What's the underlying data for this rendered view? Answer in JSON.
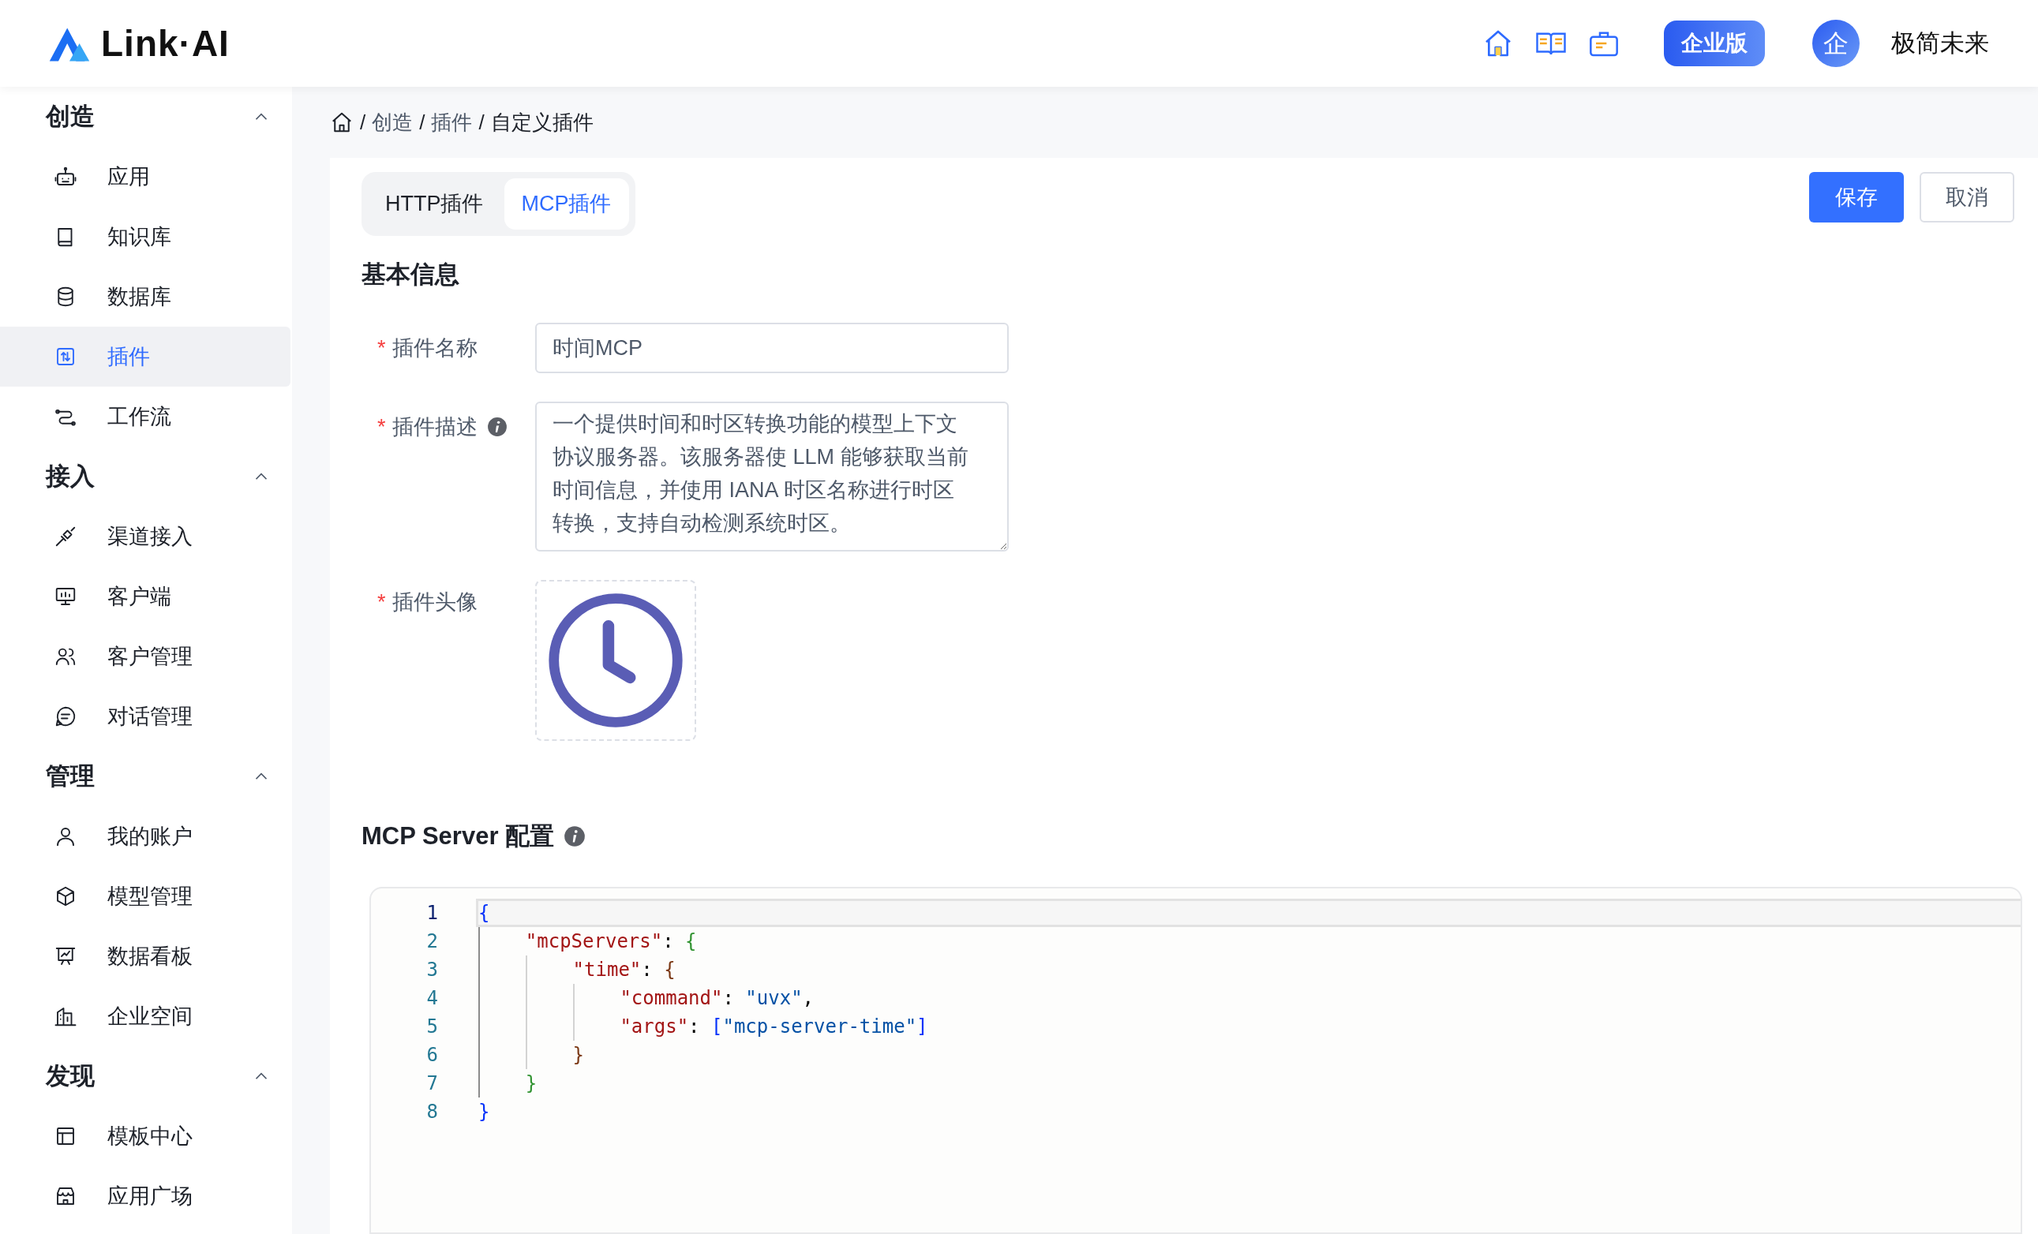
{
  "header": {
    "logo_text": "Link·AI",
    "enterprise_button": "企业版",
    "avatar_text": "企",
    "user_name": "极简未来"
  },
  "sidebar": {
    "groups": [
      {
        "title": "创造",
        "expanded": true,
        "items": [
          {
            "label": "应用",
            "selected": false
          },
          {
            "label": "知识库",
            "selected": false
          },
          {
            "label": "数据库",
            "selected": false
          },
          {
            "label": "插件",
            "selected": true
          },
          {
            "label": "工作流",
            "selected": false
          }
        ]
      },
      {
        "title": "接入",
        "expanded": true,
        "items": [
          {
            "label": "渠道接入",
            "selected": false
          },
          {
            "label": "客户端",
            "selected": false
          },
          {
            "label": "客户管理",
            "selected": false
          },
          {
            "label": "对话管理",
            "selected": false
          }
        ]
      },
      {
        "title": "管理",
        "expanded": true,
        "items": [
          {
            "label": "我的账户",
            "selected": false
          },
          {
            "label": "模型管理",
            "selected": false
          },
          {
            "label": "数据看板",
            "selected": false
          },
          {
            "label": "企业空间",
            "selected": false
          }
        ]
      },
      {
        "title": "发现",
        "expanded": true,
        "items": [
          {
            "label": "模板中心",
            "selected": false
          },
          {
            "label": "应用广场",
            "selected": false
          }
        ]
      }
    ]
  },
  "breadcrumb": [
    {
      "separator": "/",
      "label": "创造",
      "current": false
    },
    {
      "separator": "/",
      "label": "插件",
      "current": false
    },
    {
      "separator": "/",
      "label": "自定义插件",
      "current": true
    }
  ],
  "tabs": [
    {
      "label": "HTTP插件",
      "selected": false
    },
    {
      "label": "MCP插件",
      "selected": true
    }
  ],
  "actions": {
    "save": "保存",
    "cancel": "取消"
  },
  "basic_info": {
    "title": "基本信息",
    "fields": [
      {
        "kind": "text",
        "required_mark": "*",
        "label": "插件名称",
        "value": "时间MCP"
      },
      {
        "kind": "textarea",
        "required_mark": "*",
        "label": "插件描述",
        "info": true,
        "value": "一个提供时间和时区转换功能的模型上下文协议服务器。该服务器使 LLM 能够获取当前时间信息，并使用 IANA 时区名称进行时区转换，支持自动检测系统时区。"
      },
      {
        "kind": "avatar",
        "required_mark": "*",
        "label": "插件头像"
      }
    ]
  },
  "mcp_config": {
    "title": "MCP Server 配置",
    "info": true,
    "lines": [
      {
        "number": "1",
        "current": true,
        "tokens": [
          {
            "kind": "brace0",
            "text": "{"
          }
        ]
      },
      {
        "number": "2",
        "current": false,
        "tokens": [
          {
            "kind": "key",
            "text": "    \"mcpServers\""
          },
          {
            "kind": "punct",
            "text": ": "
          },
          {
            "kind": "brace1",
            "text": "{"
          }
        ]
      },
      {
        "number": "3",
        "current": false,
        "tokens": [
          {
            "kind": "key",
            "text": "        \"time\""
          },
          {
            "kind": "punct",
            "text": ": "
          },
          {
            "kind": "brace2",
            "text": "{"
          }
        ]
      },
      {
        "number": "4",
        "current": false,
        "tokens": [
          {
            "kind": "key",
            "text": "            \"command\""
          },
          {
            "kind": "punct",
            "text": ": "
          },
          {
            "kind": "string",
            "text": "\"uvx\""
          },
          {
            "kind": "punct",
            "text": ","
          }
        ]
      },
      {
        "number": "5",
        "current": false,
        "tokens": [
          {
            "kind": "key",
            "text": "            \"args\""
          },
          {
            "kind": "punct",
            "text": ": "
          },
          {
            "kind": "brace0",
            "text": "["
          },
          {
            "kind": "string",
            "text": "\"mcp-server-time\""
          },
          {
            "kind": "brace0",
            "text": "]"
          }
        ]
      },
      {
        "number": "6",
        "current": false,
        "tokens": [
          {
            "kind": "brace2",
            "text": "        }"
          }
        ]
      },
      {
        "number": "7",
        "current": false,
        "tokens": [
          {
            "kind": "brace1",
            "text": "    }"
          }
        ]
      },
      {
        "number": "8",
        "current": false,
        "tokens": [
          {
            "kind": "brace0",
            "text": "}"
          }
        ]
      }
    ]
  }
}
